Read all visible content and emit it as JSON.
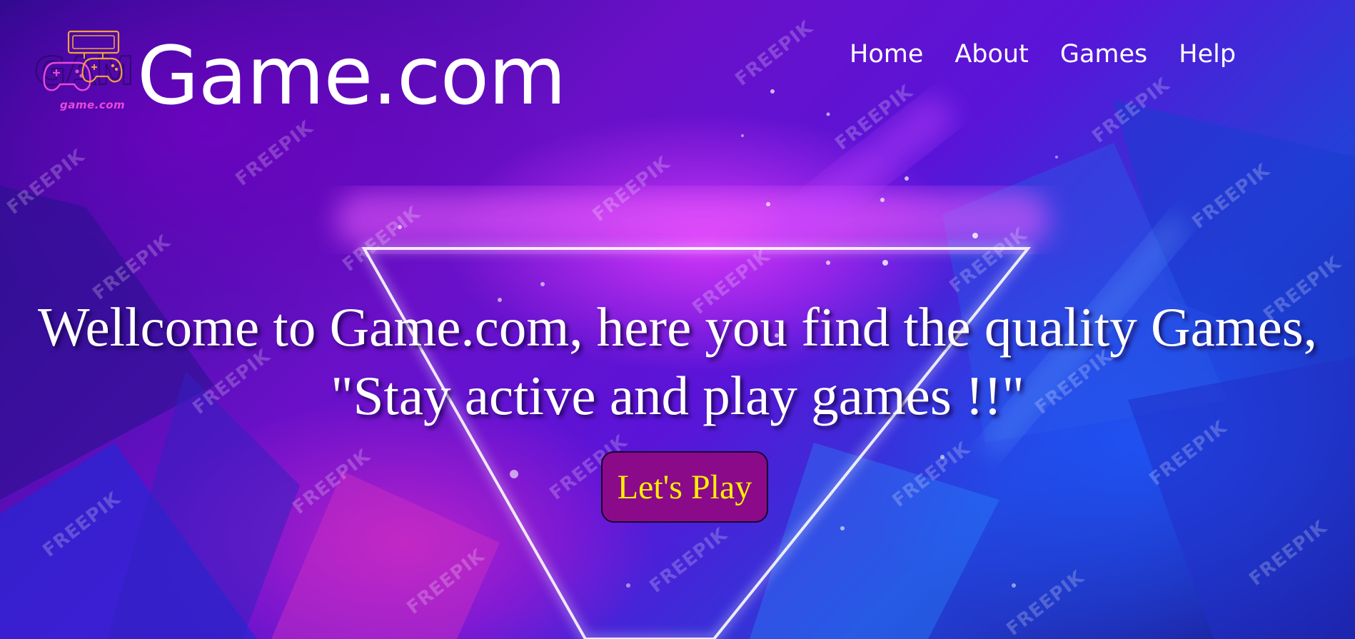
{
  "site": {
    "brand": "Game.com",
    "logo_caption": "game.com",
    "logo_bg_text": "GAME",
    "watermark": "FREEPIK"
  },
  "nav": {
    "items": [
      {
        "label": "Home"
      },
      {
        "label": "About"
      },
      {
        "label": "Games"
      },
      {
        "label": "Help"
      }
    ]
  },
  "hero": {
    "line1": "Wellcome to Game.com, here you find the quality Games,",
    "line2": "\"Stay active and play games !!\"",
    "cta_label": "Let's Play"
  },
  "colors": {
    "cta_bg": "#8a0a8a",
    "cta_text": "#ffee00",
    "logo_accent": "#f0a040",
    "logo_caption": "#e84ad8"
  }
}
